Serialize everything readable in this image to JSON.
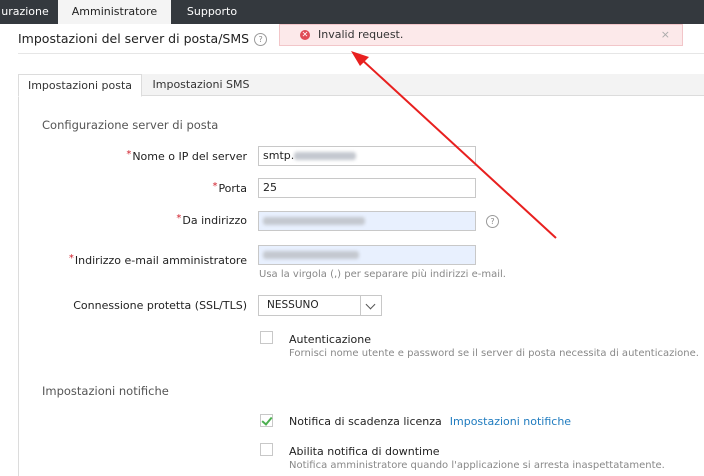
{
  "nav": {
    "items": [
      {
        "label": "urazione"
      },
      {
        "label": "Amministratore"
      },
      {
        "label": "Supporto"
      }
    ]
  },
  "page": {
    "title": "Impostazioni del server di posta/SMS",
    "help_glyph": "?"
  },
  "alert": {
    "message": "Invalid request.",
    "icon": "error-icon",
    "close_glyph": "×",
    "color": "#e04b55"
  },
  "tabs": [
    {
      "label": "Impostazioni posta"
    },
    {
      "label": "Impostazioni SMS"
    }
  ],
  "mail": {
    "section_title": "Configurazione server di posta",
    "required_mark": "*",
    "server": {
      "label": "Nome o IP del server",
      "value": "smtp."
    },
    "port": {
      "label": "Porta",
      "value": "25"
    },
    "from": {
      "label": "Da indirizzo"
    },
    "admin_email": {
      "label": "Indirizzo e-mail amministratore",
      "hint": "Usa la virgola (,) per separare più indirizzi e-mail."
    },
    "secure": {
      "label": "Connessione protetta (SSL/TLS)",
      "value": "NESSUNO"
    },
    "auth": {
      "label": "Autenticazione",
      "hint": "Fornisci nome utente e password se il server di posta necessita di autenticazione.",
      "checked": false
    }
  },
  "notifications": {
    "section_title": "Impostazioni notifiche",
    "license": {
      "label": "Notifica di scadenza licenza",
      "link": "Impostazioni notifiche",
      "checked": true
    },
    "downtime": {
      "label": "Abilita notifica di downtime",
      "hint": "Notifica amministratore quando l'applicazione si arresta inaspettatamente.",
      "checked": false
    }
  },
  "annotation": {
    "color": "#e8201f"
  }
}
